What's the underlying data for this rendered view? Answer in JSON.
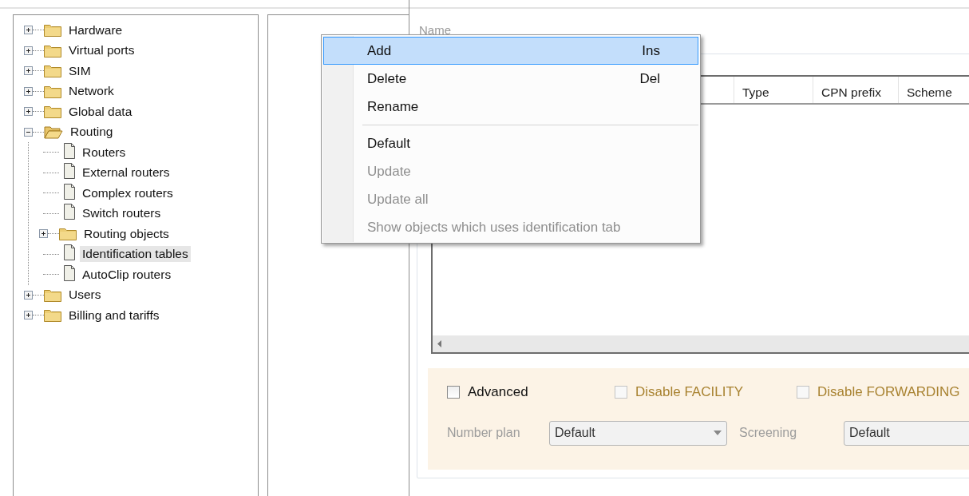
{
  "tree": [
    {
      "label": "Hardware",
      "kind": "folder",
      "expanded": false,
      "selected": false
    },
    {
      "label": "Virtual ports",
      "kind": "folder",
      "expanded": false,
      "selected": false
    },
    {
      "label": "SIM",
      "kind": "folder",
      "expanded": false,
      "selected": false
    },
    {
      "label": "Network",
      "kind": "folder",
      "expanded": false,
      "selected": false
    },
    {
      "label": "Global data",
      "kind": "folder",
      "expanded": false,
      "selected": false
    },
    {
      "label": "Routing",
      "kind": "folder",
      "expanded": true,
      "selected": false,
      "children": [
        {
          "label": "Routers",
          "kind": "document",
          "selected": false
        },
        {
          "label": "External routers",
          "kind": "document",
          "selected": false
        },
        {
          "label": "Complex routers",
          "kind": "document",
          "selected": false
        },
        {
          "label": "Switch routers",
          "kind": "document",
          "selected": false
        },
        {
          "label": "Routing objects",
          "kind": "folder",
          "expanded": false,
          "selected": false
        },
        {
          "label": "Identification tables",
          "kind": "document",
          "selected": true
        },
        {
          "label": "AutoClip routers",
          "kind": "document",
          "selected": false
        }
      ]
    },
    {
      "label": "Users",
      "kind": "folder",
      "expanded": false,
      "selected": false
    },
    {
      "label": "Billing and tariffs",
      "kind": "folder",
      "expanded": false,
      "selected": false
    }
  ],
  "name_label": "Name",
  "table": {
    "columns": [
      "Type",
      "CPN prefix",
      "Scheme"
    ]
  },
  "options": {
    "checkboxes": [
      {
        "label": "Advanced",
        "checked": false,
        "disabled": false
      },
      {
        "label": "Disable FACILITY",
        "checked": false,
        "disabled": true
      },
      {
        "label": "Disable FORWARDING",
        "checked": false,
        "disabled": true
      }
    ],
    "fields": [
      {
        "label": "Number plan",
        "value": "Default",
        "kind": "dropdown",
        "disabled": true
      },
      {
        "label": "Screening",
        "value": "Default",
        "kind": "field",
        "disabled": true
      }
    ]
  },
  "context_menu": {
    "items": [
      {
        "kind": "item",
        "label": "Add",
        "shortcut": "Ins",
        "selected": true,
        "disabled": false
      },
      {
        "kind": "item",
        "label": "Delete",
        "shortcut": "Del",
        "selected": false,
        "disabled": false
      },
      {
        "kind": "item",
        "label": "Rename",
        "selected": false,
        "disabled": false
      },
      {
        "kind": "separator"
      },
      {
        "kind": "item",
        "label": "Default",
        "selected": false,
        "disabled": false
      },
      {
        "kind": "item",
        "label": "Update",
        "selected": false,
        "disabled": true
      },
      {
        "kind": "item",
        "label": "Update all",
        "selected": false,
        "disabled": true
      },
      {
        "kind": "item",
        "label": "Show objects which uses identification tab",
        "selected": false,
        "disabled": true
      }
    ]
  }
}
